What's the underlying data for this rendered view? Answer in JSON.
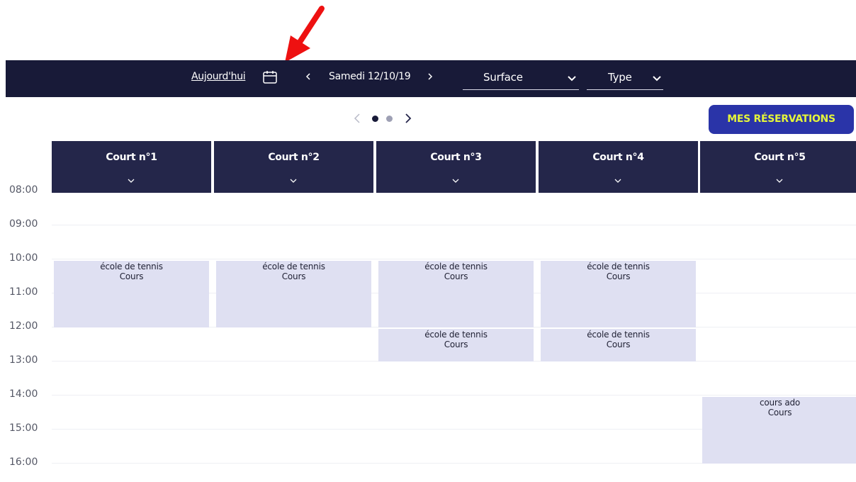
{
  "toolbar": {
    "today_label": "Aujourd'hui",
    "date_label": "Samedi 12/10/19",
    "surface_label": "Surface",
    "type_label": "Type"
  },
  "reservations_button": "MES RÉSERVATIONS",
  "pager": {
    "page_count": 2,
    "active_page": 1
  },
  "courts": [
    {
      "name": "Court n°1"
    },
    {
      "name": "Court n°2"
    },
    {
      "name": "Court n°3"
    },
    {
      "name": "Court n°4"
    },
    {
      "name": "Court n°5"
    }
  ],
  "time_slots": [
    "08:00",
    "09:00",
    "10:00",
    "11:00",
    "12:00",
    "13:00",
    "14:00",
    "15:00",
    "16:00"
  ],
  "events": [
    {
      "court": 1,
      "start": "10:00",
      "end": "12:00",
      "title": "école de tennis",
      "subtitle": "Cours"
    },
    {
      "court": 2,
      "start": "10:00",
      "end": "12:00",
      "title": "école de tennis",
      "subtitle": "Cours"
    },
    {
      "court": 3,
      "start": "10:00",
      "end": "12:00",
      "title": "école de tennis",
      "subtitle": "Cours"
    },
    {
      "court": 3,
      "start": "12:00",
      "end": "13:00",
      "title": "école de tennis",
      "subtitle": "Cours"
    },
    {
      "court": 4,
      "start": "10:00",
      "end": "12:00",
      "title": "école de tennis",
      "subtitle": "Cours"
    },
    {
      "court": 4,
      "start": "12:00",
      "end": "13:00",
      "title": "école de tennis",
      "subtitle": "Cours"
    },
    {
      "court": 5,
      "start": "14:00",
      "end": "16:00",
      "title": "cours ado",
      "subtitle": "Cours"
    }
  ],
  "colors": {
    "navbar": "#181a38",
    "court_header": "#24264a",
    "button": "#2a34a8",
    "button_text": "#e4f53a",
    "event_bg": "#dfe0f2",
    "annotation_arrow": "#ee1111"
  }
}
